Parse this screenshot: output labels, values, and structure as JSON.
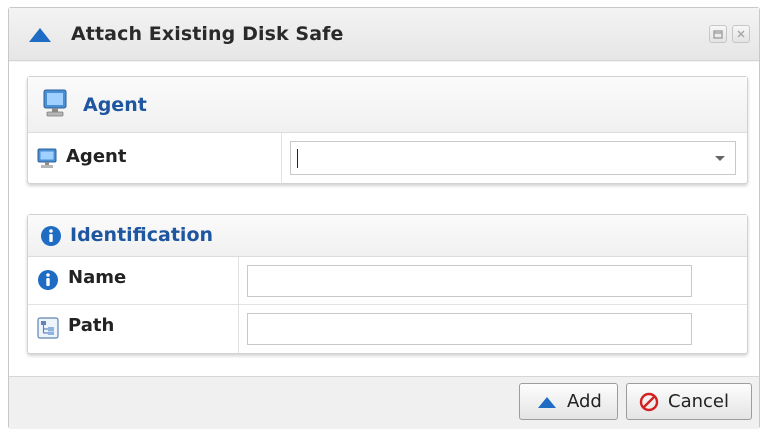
{
  "dialog": {
    "title": "Attach Existing Disk Safe",
    "title_icon": "up-triangle-icon",
    "window_buttons": [
      "restore-icon",
      "close-icon"
    ]
  },
  "agent_section": {
    "header": "Agent",
    "header_icon": "computer-icon",
    "fields": [
      {
        "label": "Agent",
        "icon": "computer-icon",
        "type": "combobox",
        "value": ""
      }
    ]
  },
  "identification_section": {
    "header": "Identification",
    "header_icon": "info-icon",
    "fields": [
      {
        "label": "Name",
        "icon": "info-icon",
        "type": "text",
        "value": ""
      },
      {
        "label": "Path",
        "icon": "folder-tree-icon",
        "type": "text",
        "value": ""
      }
    ]
  },
  "footer": {
    "add_label": "Add",
    "add_icon": "up-triangle-icon",
    "cancel_label": "Cancel",
    "cancel_icon": "cancel-circle-icon"
  },
  "colors": {
    "section_header_text": "#1e56a0",
    "icon_blue": "#1f6cc4",
    "cancel_red": "#d42020"
  }
}
